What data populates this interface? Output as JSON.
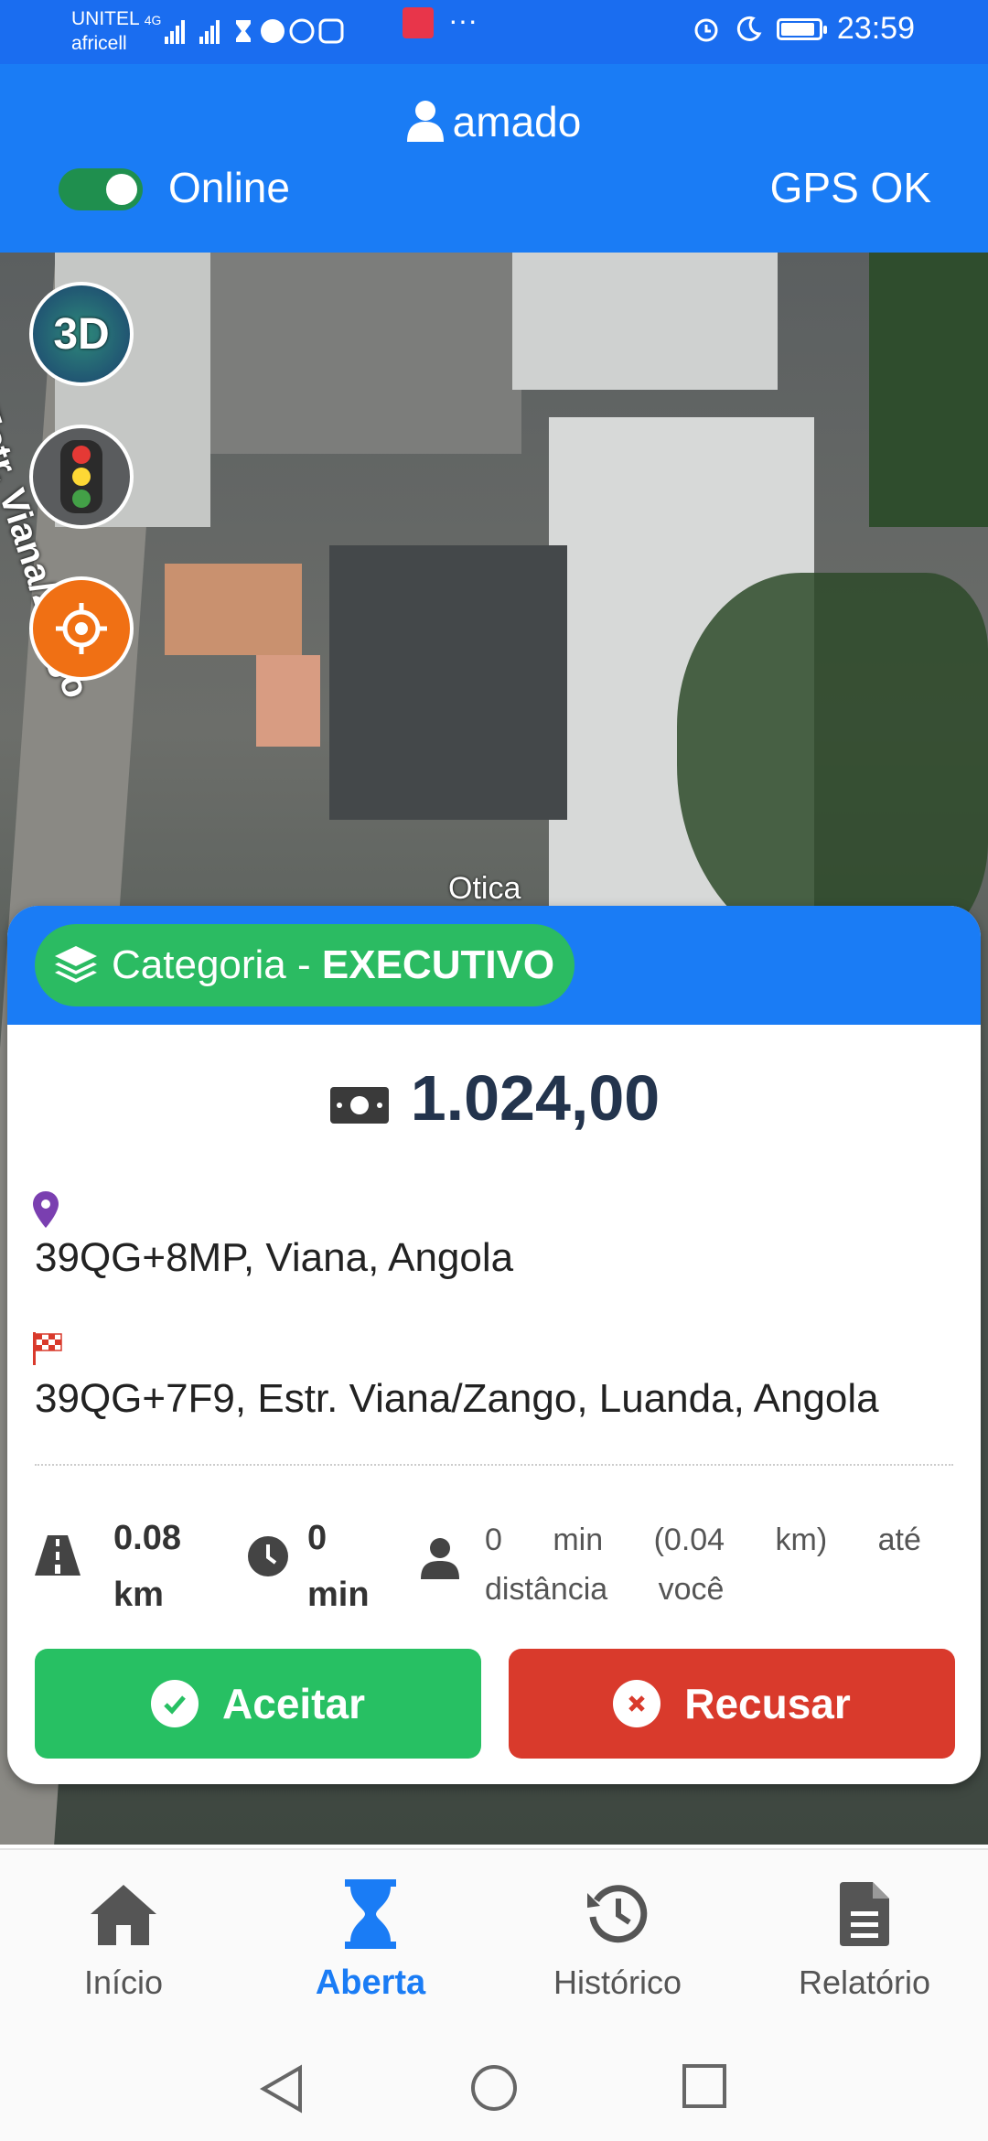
{
  "status_bar": {
    "carrier_1": "UNITEL",
    "network": "4G",
    "carrier_2": "africell",
    "time": "23:59",
    "more_indicator": "···"
  },
  "header": {
    "username": "amado",
    "online_label": "Online",
    "online_enabled": true,
    "gps_status": "GPS OK"
  },
  "map": {
    "street_label": "Estr. Viana/Zango",
    "poi_label": "Otica",
    "buttons": [
      "3D",
      "traffic-light",
      "locate"
    ],
    "button_3d_label": "3D"
  },
  "ride_card": {
    "category_prefix": "Categoria - ",
    "category_value": "EXECUTIVO",
    "price": "1.024,00",
    "pickup_address": "39QG+8MP, Viana, Angola",
    "destination_address": "39QG+7F9, Estr. Viana/Zango, Luanda, Angola",
    "distance_value": "0.08",
    "distance_unit": "km",
    "time_value": "0",
    "time_unit": "min",
    "to_you_text": "0 min (0.04 km) até distância você",
    "accept_label": "Aceitar",
    "refuse_label": "Recusar",
    "colors": {
      "accept": "#27c063",
      "refuse": "#d93a2c",
      "header": "#1a7cf5",
      "category": "#2bbb62"
    }
  },
  "bottom_nav": {
    "items": [
      {
        "label": "Início",
        "icon": "home-icon",
        "active": false
      },
      {
        "label": "Aberta",
        "icon": "hourglass-icon",
        "active": true
      },
      {
        "label": "Histórico",
        "icon": "history-icon",
        "active": false
      },
      {
        "label": "Relatório",
        "icon": "report-icon",
        "active": false
      }
    ]
  }
}
